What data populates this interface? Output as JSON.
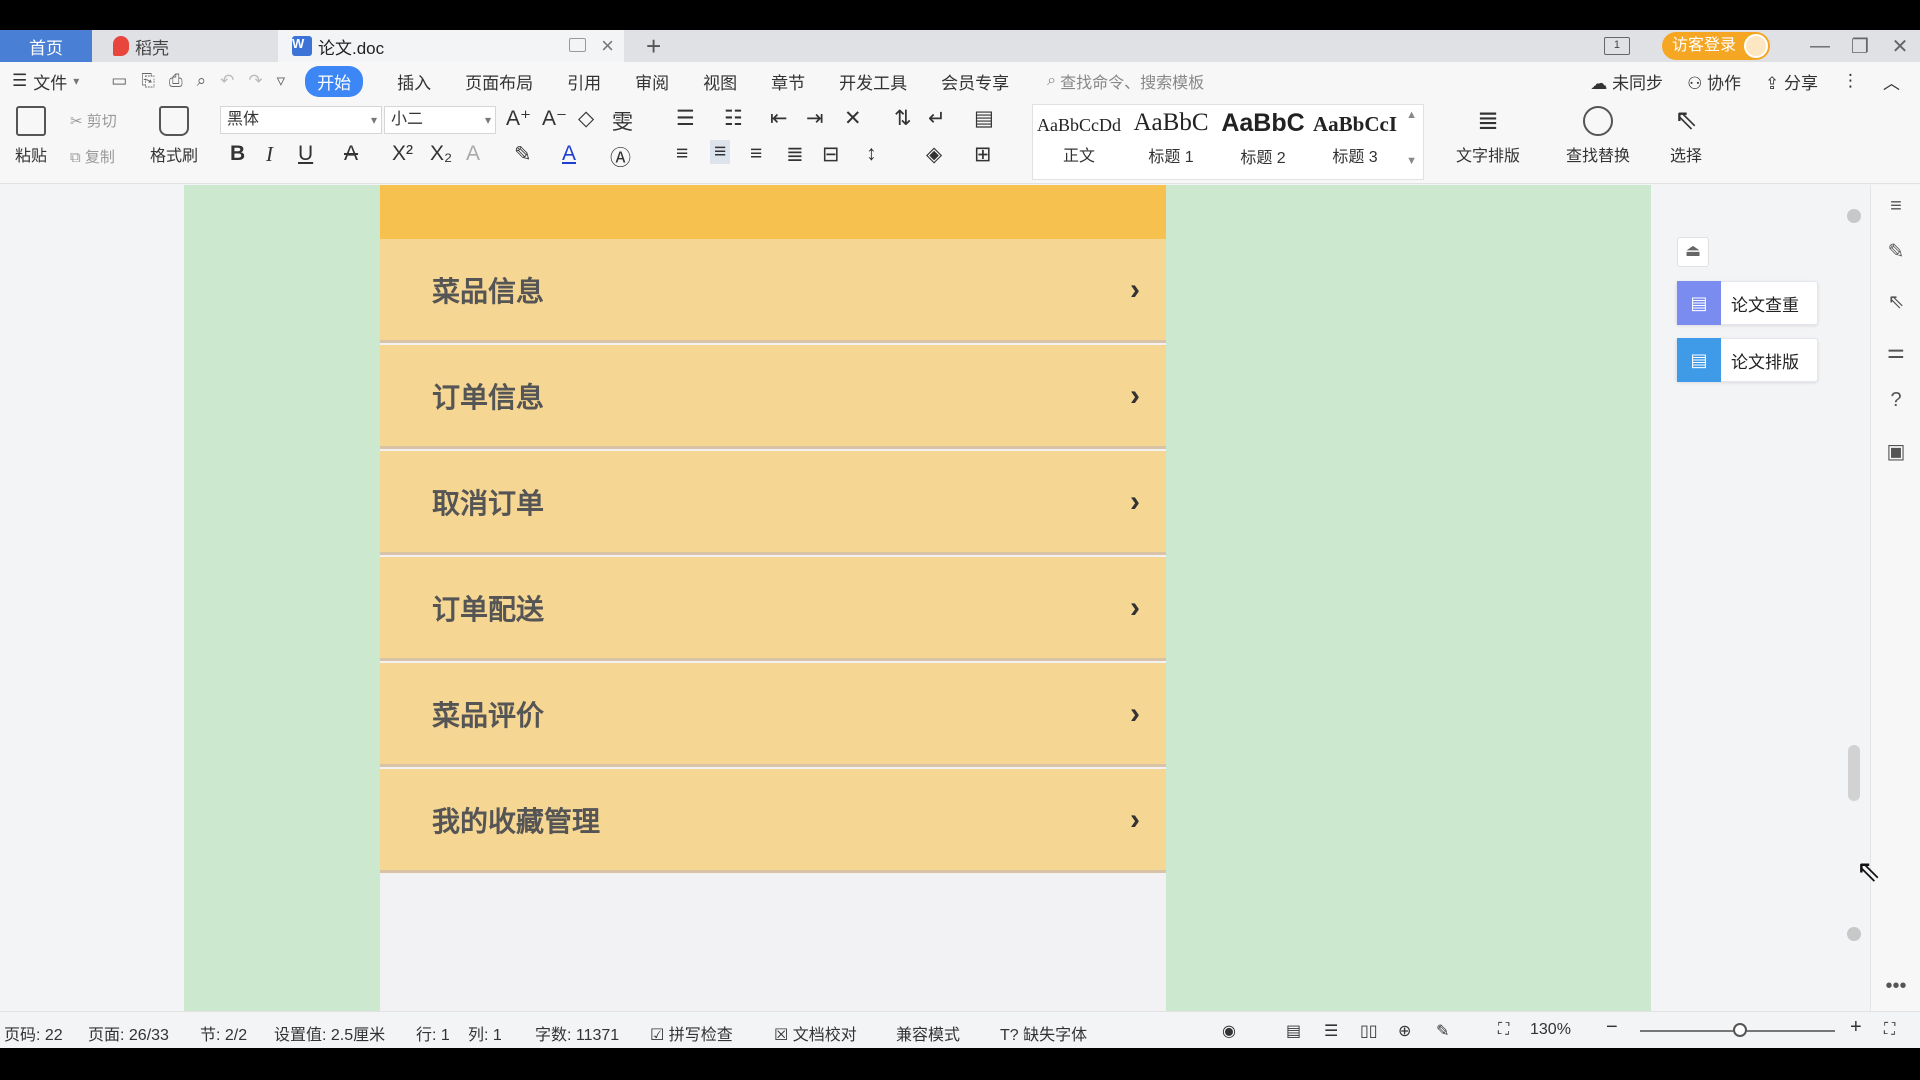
{
  "tabs": {
    "home": "首页",
    "daoke": "稻壳",
    "document": "论文.doc",
    "new_tab": "+"
  },
  "window": {
    "layout_indicator": "1",
    "visitor_login": "访客登录",
    "minimize": "—",
    "restore": "❐",
    "close": "✕"
  },
  "menu": {
    "file": "文件",
    "items": [
      "开始",
      "插入",
      "页面布局",
      "引用",
      "审阅",
      "视图",
      "章节",
      "开发工具",
      "会员专享"
    ],
    "search_placeholder": "查找命令、搜索模板",
    "unsync": "未同步",
    "collab": "协作",
    "share": "分享"
  },
  "ribbon": {
    "paste": "粘贴",
    "cut": "剪切",
    "copy": "复制",
    "format_painter": "格式刷",
    "font_name": "黑体",
    "font_size": "小二",
    "bold": "B",
    "italic": "I",
    "underline": "U",
    "styles": [
      {
        "preview": "AaBbCcDd",
        "name": "正文"
      },
      {
        "preview": "AaBbC",
        "name": "标题 1"
      },
      {
        "preview": "AaBbC",
        "name": "标题 2"
      },
      {
        "preview": "AaBbCcI",
        "name": "标题 3"
      }
    ],
    "text_layout": "文字排版",
    "find_replace": "查找替换",
    "select": "选择"
  },
  "document": {
    "menu_items": [
      "菜品信息",
      "订单信息",
      "取消订单",
      "订单配送",
      "菜品评价",
      "我的收藏管理"
    ],
    "chevron": "›"
  },
  "side_panel": {
    "check": "论文查重",
    "layout": "论文排版"
  },
  "status": {
    "page_code": "页码: 22",
    "page": "页面: 26/33",
    "section": "节: 2/2",
    "setting": "设置值: 2.5厘米",
    "row": "行: 1",
    "col": "列: 1",
    "word_count": "字数: 11371",
    "spell_check": "拼写检查",
    "doc_proof": "文档校对",
    "compat_mode": "兼容模式",
    "missing_font": "缺失字体",
    "zoom": "130%",
    "zoom_level": 0.55
  },
  "colors": {
    "accent": "#3c86f5",
    "page_bg": "#cce8cf",
    "menu_item_bg": "#f6d693",
    "menu_header_bg": "#f6c14e",
    "visitor": "#f5a623"
  }
}
